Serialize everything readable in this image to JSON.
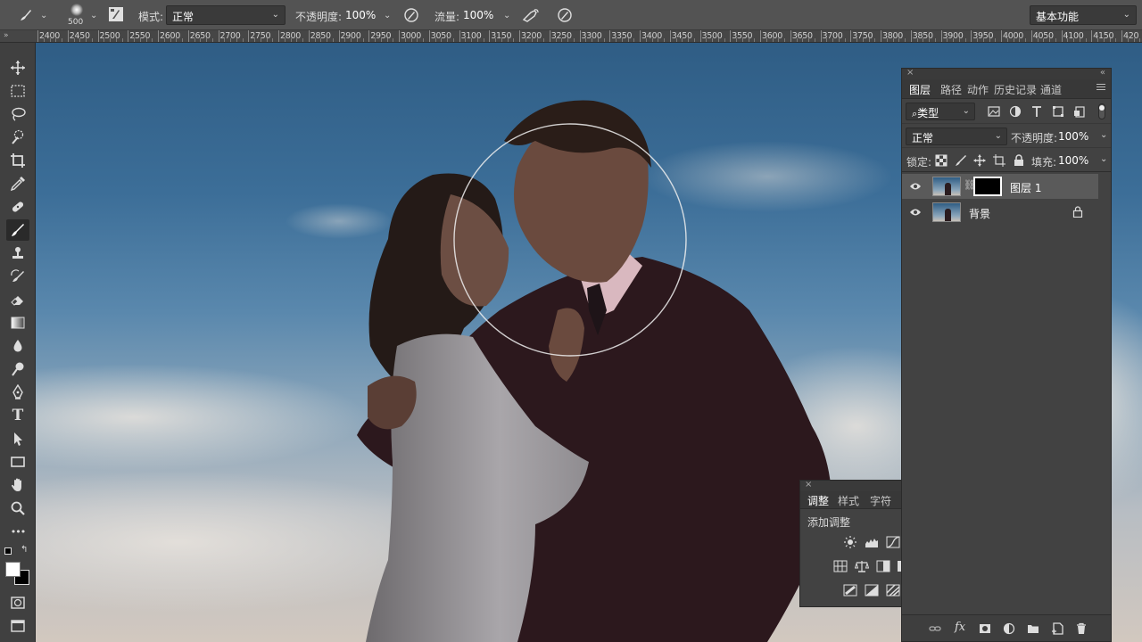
{
  "options_bar": {
    "brush_size": "500",
    "mode_label": "模式:",
    "mode_value": "正常",
    "opacity_label": "不透明度:",
    "opacity_value": "100%",
    "flow_label": "流量:",
    "flow_value": "100%",
    "workspace": "基本功能"
  },
  "ruler": {
    "collapse": "»",
    "labels": [
      "2400",
      "2450",
      "2500",
      "2550",
      "2600",
      "2650",
      "2700",
      "2750",
      "2800",
      "2850",
      "2900",
      "2950",
      "3000",
      "3050",
      "3100",
      "3150",
      "3200",
      "3250",
      "3300",
      "3350",
      "3400",
      "3450",
      "3500",
      "3550",
      "3600",
      "3650",
      "3700",
      "3750",
      "3800",
      "3850",
      "3900",
      "3950",
      "4000",
      "4050",
      "4100",
      "4150",
      "420"
    ]
  },
  "toolbar": {
    "tools": [
      "move-tool",
      "marquee-tool",
      "lasso-tool",
      "quick-select-tool",
      "crop-tool",
      "eyedropper-tool",
      "healing-tool",
      "brush-tool",
      "stamp-tool",
      "history-brush-tool",
      "eraser-tool",
      "gradient-tool",
      "blur-tool",
      "dodge-tool",
      "pen-tool",
      "type-tool",
      "path-select-tool",
      "rectangle-tool",
      "hand-tool",
      "zoom-tool",
      "more-tools"
    ],
    "active_tool": "brush-tool",
    "type_glyph": "T",
    "more_glyph": "•••",
    "foreground_color": "#ffffff",
    "background_color": "#000000"
  },
  "layers_panel": {
    "close": "×",
    "collapse": "«",
    "tabs": [
      "图层",
      "路径",
      "动作",
      "历史记录",
      "通道"
    ],
    "active_tab": "图层",
    "filter_label": "类型",
    "blend_mode": "正常",
    "opacity_label": "不透明度:",
    "opacity_value": "100%",
    "lock_label": "锁定:",
    "fill_label": "填充:",
    "fill_value": "100%",
    "layers": [
      {
        "name": "图层 1",
        "selected": true,
        "has_mask": true
      },
      {
        "name": "背景",
        "selected": false,
        "locked": true
      }
    ]
  },
  "adjustments_panel": {
    "close": "×",
    "tabs": [
      "调整",
      "样式",
      "字符"
    ],
    "active_tab": "调整",
    "title": "添加调整"
  },
  "colors": {
    "panel_bg": "#424242",
    "toolbar_bg": "#404040",
    "options_bg": "#535353",
    "sky_top": "#2f5d85",
    "sky_bottom": "#d2c8bf"
  }
}
